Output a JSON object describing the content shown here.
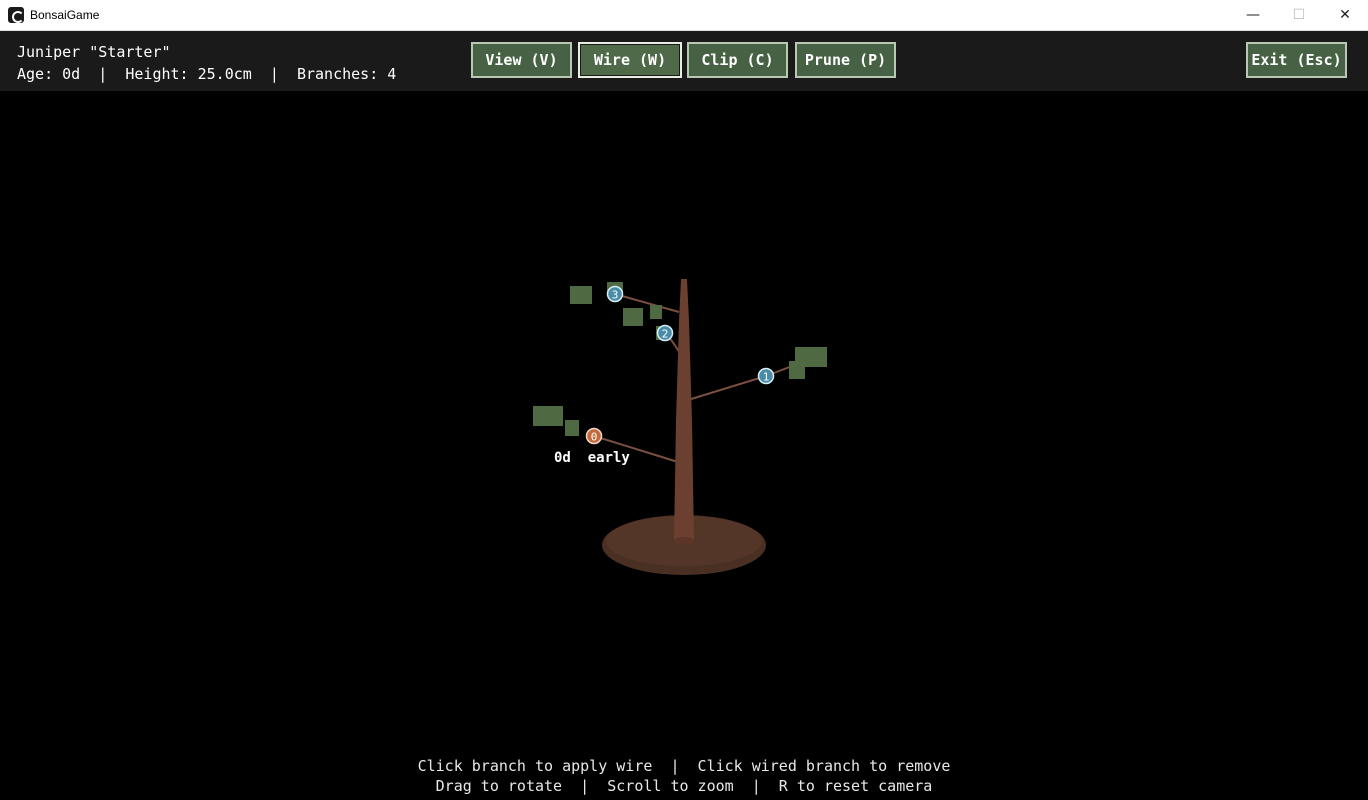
{
  "window": {
    "title": "BonsaiGame",
    "minimize": "—",
    "maximize": "☐",
    "close": "✕"
  },
  "hud": {
    "tree_name": "Juniper \"Starter\"",
    "age": "Age: 0d",
    "height": "Height: 25.0cm",
    "branches": "Branches: 4",
    "separator": "|"
  },
  "toolbar": {
    "view": "View (V)",
    "wire": "Wire (W)",
    "clip": "Clip (C)",
    "prune": "Prune (P)",
    "exit": "Exit (Esc)",
    "active_tool": "wire"
  },
  "scene": {
    "branch_markers": [
      {
        "label": "0",
        "color": "#c46a3c"
      },
      {
        "label": "1",
        "color": "#4a8ba8"
      },
      {
        "label": "2",
        "color": "#4a8ba8"
      },
      {
        "label": "3",
        "color": "#4a8ba8"
      }
    ],
    "branch_info": "0d  early",
    "colors": {
      "trunk": "#6b4030",
      "soil": "#4a3023",
      "foliage": "#4f6a42",
      "branch": "#7a5040"
    }
  },
  "hints": {
    "line1": "Click branch to apply wire  |  Click wired branch to remove",
    "line2": "Drag to rotate  |  Scroll to zoom  |  R to reset camera"
  }
}
